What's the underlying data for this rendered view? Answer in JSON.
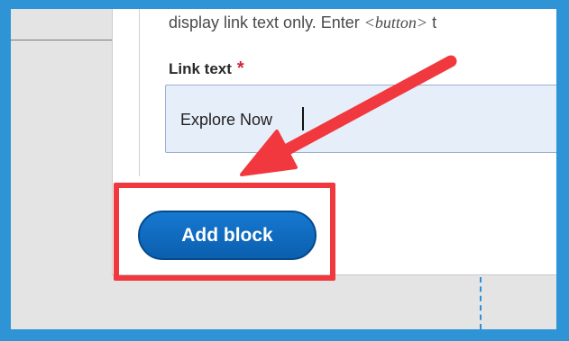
{
  "form": {
    "help_prefix": "display link text only. Enter ",
    "help_code": "<button>",
    "help_suffix": " t",
    "link_text_label": "Link text",
    "required_marker": "*",
    "link_text_value": "Explore Now"
  },
  "actions": {
    "add_block_label": "Add block"
  },
  "annotations": {
    "arrow_color": "#f0383e",
    "highlight_color": "#f0383e",
    "frame_color": "#2e94d6"
  }
}
